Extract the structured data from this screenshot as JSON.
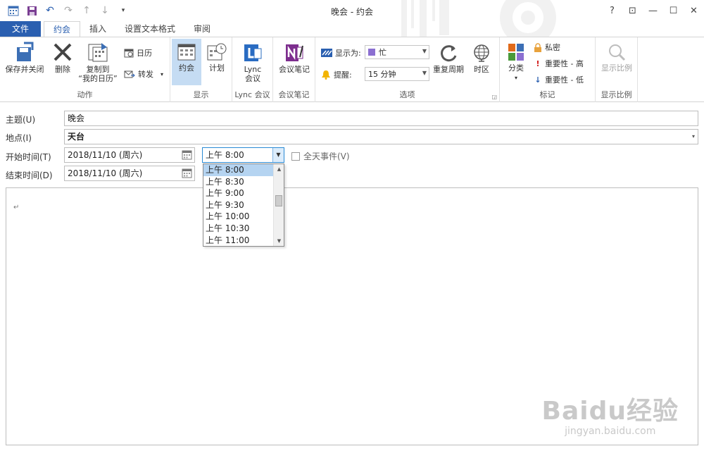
{
  "window": {
    "title": "晚会 - 约会",
    "controls": [
      "?",
      "⊡",
      "—",
      "☐",
      "✕"
    ]
  },
  "tabs": [
    {
      "label": "文件"
    },
    {
      "label": "约会"
    },
    {
      "label": "插入"
    },
    {
      "label": "设置文本格式"
    },
    {
      "label": "审阅"
    }
  ],
  "ribbon": {
    "actions": {
      "label": "动作",
      "save_close": "保存并关闭",
      "delete": "删除",
      "copy_to_line1": "复制到",
      "copy_to_line2": "“我的日历”",
      "calendar": "日历",
      "forward": "转发"
    },
    "show": {
      "label": "显示",
      "appointment": "约会",
      "plan": "计划"
    },
    "lync": {
      "label": "Lync 会议",
      "btn_line1": "Lync",
      "btn_line2": "会议"
    },
    "notes": {
      "label": "会议笔记",
      "btn": "会议笔记"
    },
    "options": {
      "label": "选项",
      "show_as_label": "显示为:",
      "show_as_value": "忙",
      "reminder_label": "提醒:",
      "reminder_value": "15 分钟",
      "recurrence": "重复周期",
      "timezone": "时区"
    },
    "tags": {
      "label": "标记",
      "categorize": "分类",
      "private": "私密",
      "high": "重要性 - 高",
      "low": "重要性 - 低"
    },
    "zoom": {
      "label": "显示比例",
      "btn": "显示比例"
    }
  },
  "form": {
    "subject_label": "主题(U)",
    "subject_value": "晚会",
    "location_label": "地点(I)",
    "location_value": "天台",
    "start_label": "开始时间(T)",
    "start_date": "2018/11/10 (周六)",
    "start_time": "上午 8:00",
    "end_label": "结束时间(D)",
    "end_date": "2018/11/10 (周六)",
    "all_day_label": "全天事件(V)"
  },
  "time_options": [
    "上午 8:00",
    "上午 8:30",
    "上午 9:00",
    "上午 9:30",
    "上午 10:00",
    "上午 10:30",
    "上午 11:00"
  ],
  "watermark": {
    "main": "Baidu经验",
    "sub": "jingyan.baidu.com"
  },
  "colors": {
    "accent": "#2a5fb0",
    "selected_bg": "#c5dcf3",
    "category_purple": "#8b6fd1"
  }
}
